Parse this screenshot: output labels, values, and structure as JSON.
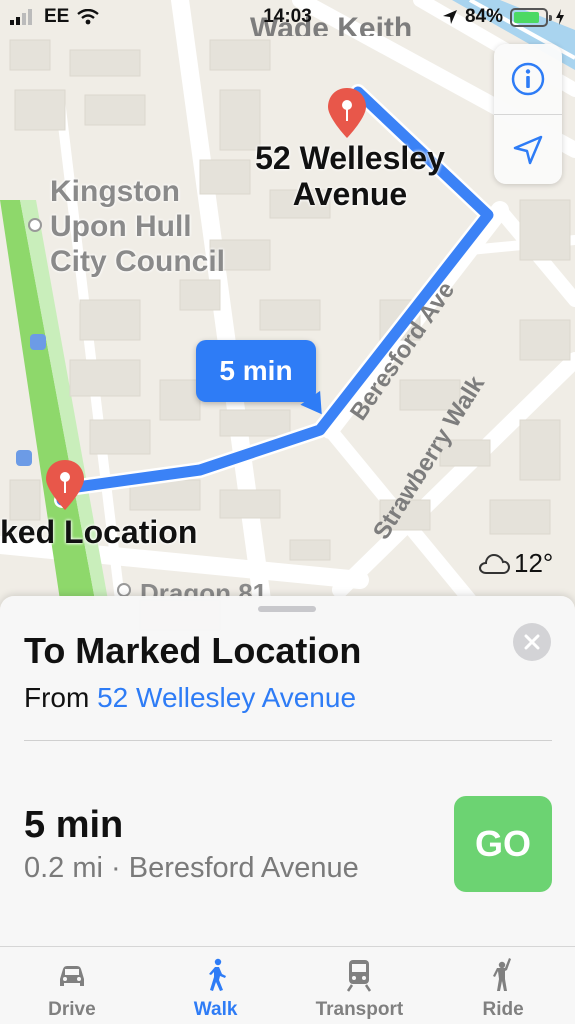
{
  "status_bar": {
    "carrier": "EE",
    "time": "14:03",
    "battery": "84%",
    "battery_level": 0.84
  },
  "map": {
    "labels": {
      "top_partial": "Wade Keith",
      "destination": "52 Wellesley\nAvenue",
      "council": "Kingston\nUpon Hull\nCity Council",
      "street_1": "Beresford Ave",
      "street_2": "Strawberry Walk",
      "origin": "ked Location",
      "poi_bottom": "Dragon 81"
    },
    "callout": "5 min",
    "weather": "12°",
    "route_color": "#3b82f6",
    "pin_color": "#e8574a"
  },
  "sheet": {
    "title": "To Marked Location",
    "from_prefix": "From",
    "from_place": "52 Wellesley Avenue",
    "route_time": "5 min",
    "route_detail": "0.2 mi · Beresford Avenue",
    "go_label": "GO"
  },
  "tabs": [
    {
      "label": "Drive",
      "icon": "car-icon",
      "active": false
    },
    {
      "label": "Walk",
      "icon": "walk-icon",
      "active": true
    },
    {
      "label": "Transport",
      "icon": "train-icon",
      "active": false
    },
    {
      "label": "Ride",
      "icon": "ride-icon",
      "active": false
    }
  ],
  "colors": {
    "accent": "#2e7cf6",
    "go": "#6cd372"
  }
}
